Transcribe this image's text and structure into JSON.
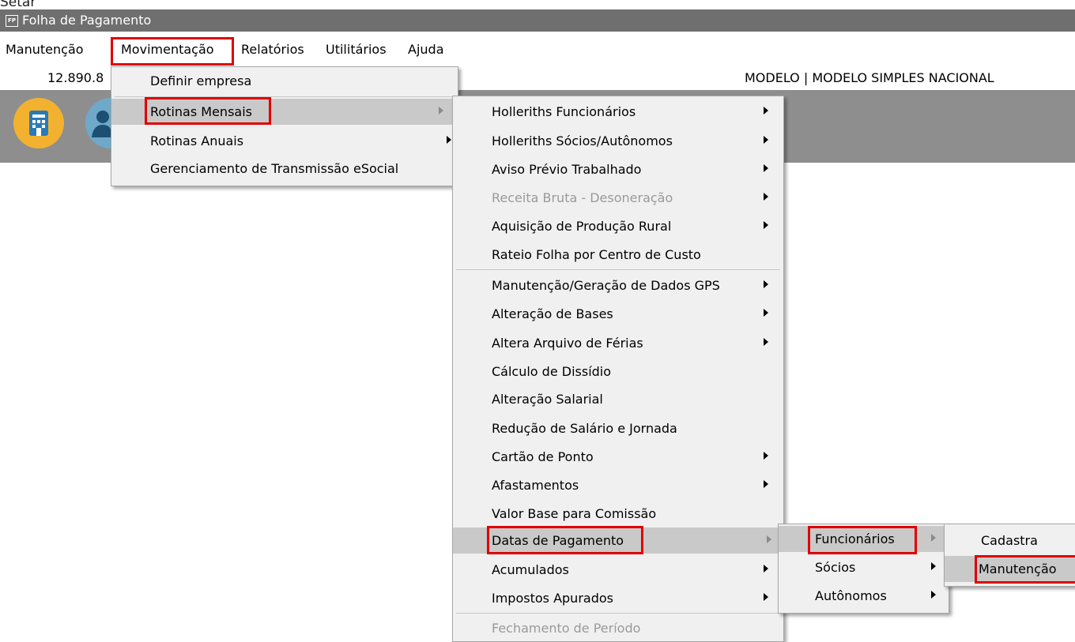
{
  "top_clip_text": "Setar",
  "window": {
    "icon_text": "FP",
    "title": "Folha de Pagamento"
  },
  "menubar": {
    "items": [
      "Manutenção",
      "Movimentação",
      "Relatórios",
      "Utilitários",
      "Ajuda"
    ]
  },
  "info": {
    "left_value": "12.890.8",
    "company": "MODELO | MODELO SIMPLES NACIONAL"
  },
  "toolbar": {
    "buttons": [
      "building-icon",
      "person-icon"
    ]
  },
  "menu_movimentacao": {
    "items": [
      "Definir empresa",
      "Rotinas Mensais",
      "Rotinas Anuais",
      "Gerenciamento de Transmissão eSocial"
    ]
  },
  "menu_rotinas_mensais": {
    "items": [
      "Holleriths Funcionários",
      "Holleriths Sócios/Autônomos",
      "Aviso Prévio Trabalhado",
      "Receita Bruta - Desoneração",
      "Aquisição de Produção Rural",
      "Rateio Folha por Centro de Custo",
      "Manutenção/Geração de Dados GPS",
      "Alteração de Bases",
      "Altera Arquivo de Férias",
      "Cálculo de Dissídio",
      "Alteração Salarial",
      "Redução de Salário e Jornada",
      "Cartão de Ponto",
      "Afastamentos",
      "Valor Base para Comissão",
      "Datas de Pagamento",
      "Acumulados",
      "Impostos Apurados",
      "Fechamento de Período"
    ]
  },
  "menu_datas_pagamento": {
    "items": [
      "Funcionários",
      "Sócios",
      "Autônomos"
    ]
  },
  "menu_funcionarios": {
    "items": [
      "Cadastra",
      "Manutenção"
    ]
  },
  "colors": {
    "highlight": "#e00000",
    "titlebar": "#6f6f6f",
    "toolbar": "#8e8e8e",
    "menu_bg": "#f0f0f0",
    "menu_selected": "#c9c9c9"
  }
}
